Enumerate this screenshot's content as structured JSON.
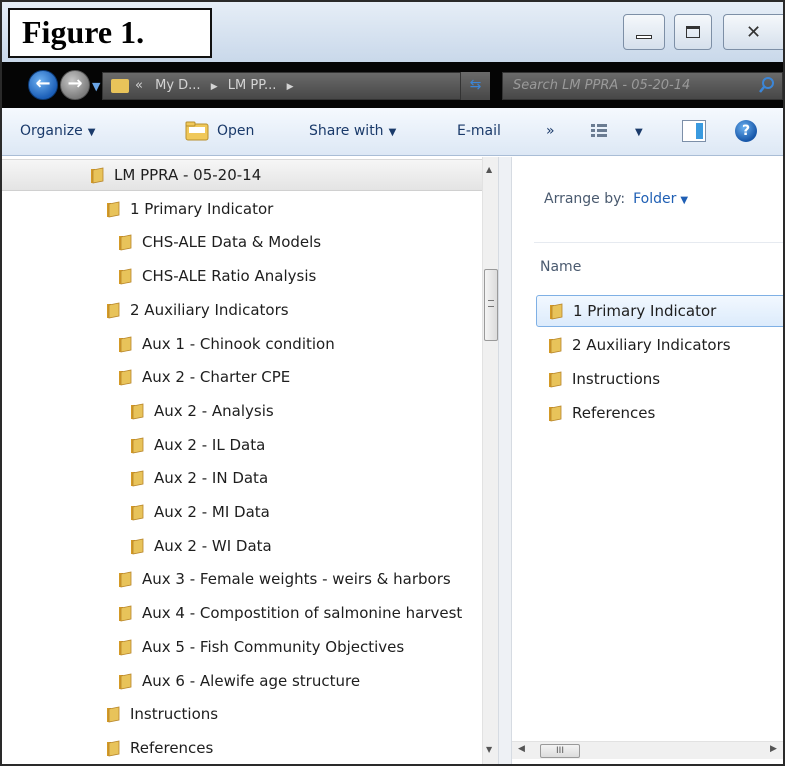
{
  "figure_label": "Figure 1.",
  "navigation": {
    "address_prefix": "«",
    "breadcrumb": [
      "My D...",
      "LM PP..."
    ],
    "separator": "▶",
    "search_placeholder": "Search LM PPRA - 05-20-14"
  },
  "commandbar": {
    "organize": "Organize",
    "open": "Open",
    "share_with": "Share with",
    "email": "E-mail",
    "more": "»"
  },
  "tree": {
    "items": [
      {
        "label": "LM PPRA - 05-20-14",
        "level": 0,
        "selected": true
      },
      {
        "label": "1 Primary Indicator",
        "level": 1
      },
      {
        "label": "CHS-ALE Data & Models",
        "level": 2
      },
      {
        "label": "CHS-ALE Ratio Analysis",
        "level": 2
      },
      {
        "label": "2 Auxiliary Indicators",
        "level": 1
      },
      {
        "label": "Aux 1 - Chinook condition",
        "level": 2
      },
      {
        "label": "Aux 2 - Charter CPE",
        "level": 2
      },
      {
        "label": "Aux 2  - Analysis",
        "level": 3
      },
      {
        "label": "Aux 2 - IL Data",
        "level": 3
      },
      {
        "label": "Aux 2 - IN Data",
        "level": 3
      },
      {
        "label": "Aux 2 - MI Data",
        "level": 3
      },
      {
        "label": "Aux 2 - WI Data",
        "level": 3
      },
      {
        "label": "Aux 3 - Female weights - weirs & harbors",
        "level": 2
      },
      {
        "label": "Aux 4 - Compostition of salmonine harvest",
        "level": 2
      },
      {
        "label": "Aux 5 - Fish Community Objectives",
        "level": 2
      },
      {
        "label": "Aux 6 - Alewife age structure",
        "level": 2
      },
      {
        "label": "Instructions",
        "level": 1
      },
      {
        "label": "References",
        "level": 1
      }
    ]
  },
  "content": {
    "arrange_label": "Arrange by:",
    "arrange_value": "Folder",
    "column_header": "Name",
    "items": [
      {
        "label": "1 Primary Indicator",
        "hover": true
      },
      {
        "label": "2 Auxiliary Indicators"
      },
      {
        "label": "Instructions"
      },
      {
        "label": "References"
      }
    ]
  },
  "colors": {
    "folder": "#e8c35a",
    "accent": "#1f5fb4",
    "selection_border": "#7fb0e5"
  }
}
